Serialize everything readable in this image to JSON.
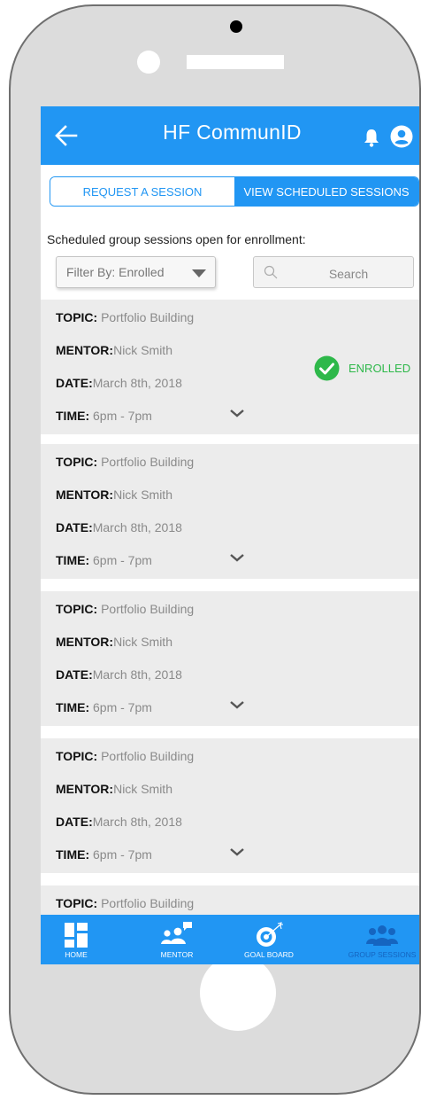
{
  "header": {
    "title": "HF CommunID",
    "back_icon": "arrow-left-icon",
    "notification_icon": "bell-icon",
    "account_icon": "account-circle-icon"
  },
  "tabs": [
    {
      "label": "REQUEST A SESSION",
      "active": false
    },
    {
      "label": "VIEW SCHEDULED SESSIONS",
      "active": true
    }
  ],
  "subtitle": "Scheduled group sessions open for enrollment:",
  "filter": {
    "label": "Filter By: Enrolled"
  },
  "search": {
    "placeholder": "Search",
    "value": ""
  },
  "field_labels": {
    "topic": "TOPIC:",
    "mentor": "MENTOR:",
    "date": "DATE:",
    "time": "TIME:"
  },
  "sessions": [
    {
      "topic": "Portfolio Building",
      "mentor": "Nick Smith",
      "date": "March 8th, 2018",
      "time": "6pm - 7pm",
      "status": "ENROLLED"
    },
    {
      "topic": "Portfolio Building",
      "mentor": "Nick Smith",
      "date": "March 8th, 2018",
      "time": "6pm - 7pm"
    },
    {
      "topic": "Portfolio Building",
      "mentor": "Nick Smith",
      "date": "March 8th, 2018",
      "time": "6pm - 7pm"
    },
    {
      "topic": "Portfolio Building",
      "mentor": "Nick Smith",
      "date": "March 8th, 2018",
      "time": "6pm - 7pm"
    },
    {
      "topic": "Portfolio Building"
    }
  ],
  "nav": [
    {
      "label": "HOME",
      "icon": "dashboard-icon",
      "active": false
    },
    {
      "label": "MENTOR",
      "icon": "mentor-chat-icon",
      "active": false
    },
    {
      "label": "GOAL BOARD",
      "icon": "target-icon",
      "active": false
    },
    {
      "label": "GROUP SESSIONS",
      "icon": "group-icon",
      "active": true
    }
  ],
  "colors": {
    "primary": "#2196f3",
    "success": "#2eb84a",
    "active_nav": "#1565c0",
    "card_bg": "#ececec"
  }
}
